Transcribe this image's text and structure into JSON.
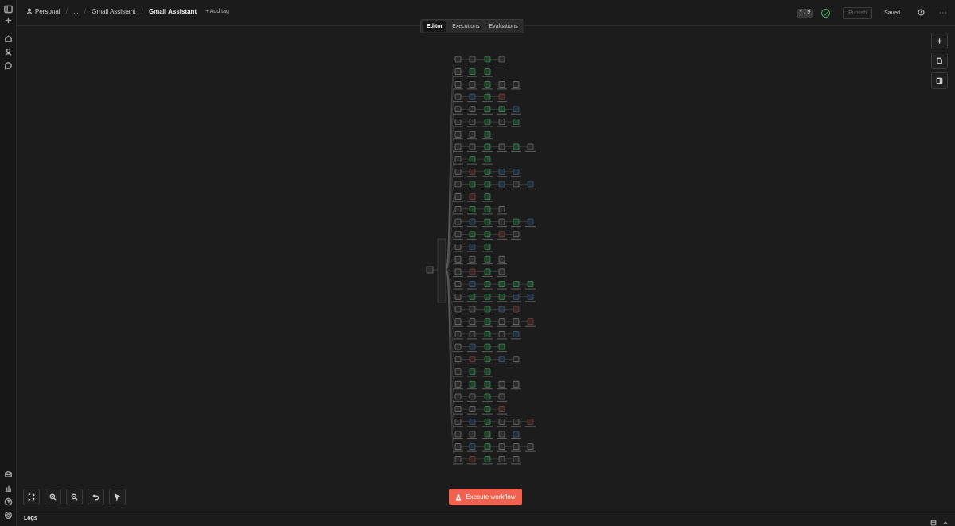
{
  "breadcrumbs": {
    "workspace": "Personal",
    "ellipsis": "...",
    "folder": "Gmail Assistant",
    "current": "Gmail Assistant",
    "add_tag": "+ Add tag"
  },
  "tabs": [
    {
      "label": "Editor",
      "active": true
    },
    {
      "label": "Executions",
      "active": false
    },
    {
      "label": "Evaluations",
      "active": false
    }
  ],
  "header_right": {
    "counter": "1 / 2",
    "publish_label": "Publish",
    "saved_label": "Saved"
  },
  "execute_label": "Execute workflow",
  "logs_label": "Logs",
  "colors": {
    "accent": "#f0624f",
    "success": "#3fae5f",
    "background": "#1c1c1c"
  },
  "icons": {
    "rail_top": [
      "sidebar-toggle-icon",
      "plus-icon"
    ],
    "rail_nav": [
      "home-icon",
      "user-icon",
      "chat-icon"
    ],
    "rail_bottom": [
      "template-icon",
      "chart-icon",
      "help-icon",
      "settings-icon"
    ],
    "canvas_right": [
      "plus-icon",
      "sticky-note-icon",
      "panel-icon"
    ],
    "canvas_bottom": [
      "fit-view-icon",
      "zoom-in-icon",
      "zoom-out-icon",
      "undo-icon",
      "pointer-icon"
    ]
  }
}
